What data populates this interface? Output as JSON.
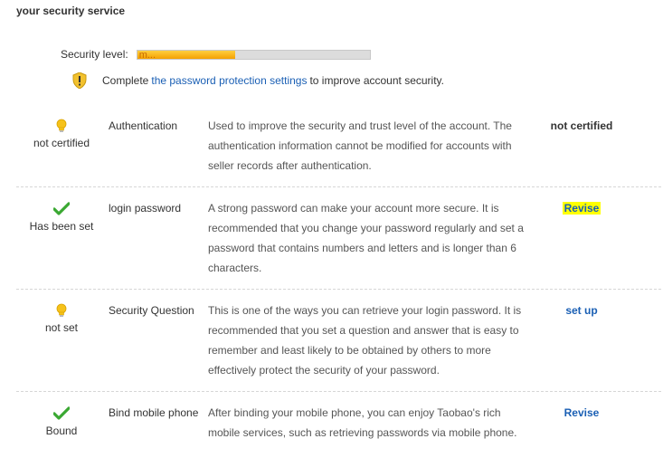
{
  "page_title": "your security service",
  "security_level": {
    "label": "Security level:",
    "bar_text": "m...",
    "progress_fraction": 0.42,
    "fill_color": "#f4a100"
  },
  "notice": {
    "icon": "shield-warning-icon",
    "prefix": "Complete",
    "link_text": "the password protection settings",
    "suffix": "to improve account security."
  },
  "items": [
    {
      "status_icon": "lightbulb-icon",
      "status": "not certified",
      "name": "Authentication",
      "description": "Used to improve the security and trust level of the account. The authentication information cannot be modified for accounts with seller records after authentication.",
      "action": "not certified"
    },
    {
      "status_icon": "checkmark-icon",
      "status": "Has been set",
      "name": "login password",
      "description": "A strong password can make your account more secure. It is recommended that you change your password regularly and set a password that contains numbers and letters and is longer than 6 characters.",
      "action": "Revise"
    },
    {
      "status_icon": "lightbulb-icon",
      "status": "not set",
      "name": "Security Question",
      "description": "This is one of the ways you can retrieve your login password. It is recommended that you set a question and answer that is easy to remember and least likely to be obtained by others to more effectively protect the security of your password.",
      "action": "set up"
    },
    {
      "status_icon": "checkmark-icon",
      "status": "Bound",
      "name": "Bind mobile phone",
      "description": "After binding your mobile phone, you can enjoy Taobao's rich mobile services, such as retrieving passwords via mobile phone.",
      "action": "Revise"
    }
  ],
  "colors": {
    "link": "#1a5fb4",
    "highlight": "#ffff00",
    "check": "#3aa832",
    "bulb": "#f6c21a"
  }
}
